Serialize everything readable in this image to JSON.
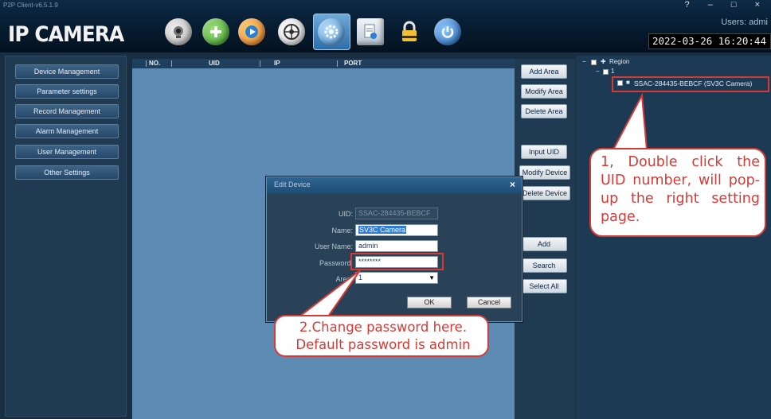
{
  "window": {
    "title": "P2P Client-v6.5.1.9",
    "logo": "IP CAMERA",
    "controls": "? – □ ×",
    "users_label": "Users: admi",
    "clock": "2022-03-26 16:20:44"
  },
  "toolbar": {
    "icons": [
      "webcam-icon",
      "add-icon",
      "playback-icon",
      "ptz-icon",
      "settings-icon",
      "document-icon",
      "lock-icon",
      "power-icon"
    ],
    "selected": "settings-icon"
  },
  "left_nav": {
    "items": [
      {
        "label": "Device Management"
      },
      {
        "label": "Parameter settings"
      },
      {
        "label": "Record Management"
      },
      {
        "label": "Alarm Management"
      },
      {
        "label": "User Management"
      },
      {
        "label": "Other Settings"
      }
    ]
  },
  "device_table": {
    "columns": [
      "NO.",
      "UID",
      "IP",
      "PORT"
    ]
  },
  "actions": {
    "add_area": "Add Area",
    "modify_area": "Modify Area",
    "delete_area": "Delete Area",
    "input_uid": "Input UID",
    "modify_device": "Modify Device",
    "delete_device": "Delete Device",
    "add": "Add",
    "search": "Search",
    "select_all": "Select All"
  },
  "tree": {
    "root": "Region",
    "group": "1",
    "device": "SSAC-284435-BEBCF (SV3C Camera)"
  },
  "dialog": {
    "title": "Edit Device",
    "close": "×",
    "uid_label": "UID:",
    "uid_value": "SSAC-284435-BEBCF",
    "name_label": "Name:",
    "name_value": "SV3C Camera",
    "username_label": "User Name:",
    "username_value": "admin",
    "password_label": "Password:",
    "password_value": "********",
    "area_label": "Area:",
    "area_value": "1",
    "ok": "OK",
    "cancel": "Cancel"
  },
  "annotations": {
    "callout1": "1, Double click the UID number, will pop-up the right setting page.",
    "callout2": "2.Change password here. Default password is admin",
    "accent": "#d63a35"
  }
}
